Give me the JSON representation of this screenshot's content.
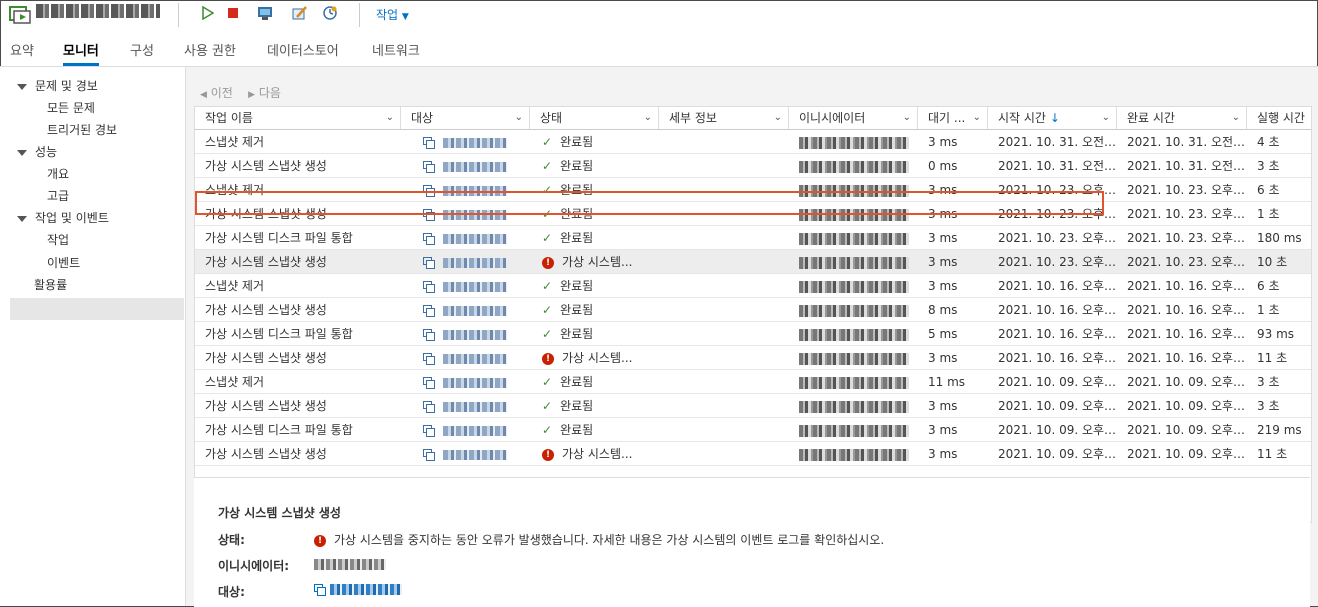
{
  "toolbar": {
    "vm_name": "█████████",
    "actions_label": "작업",
    "actions_icon": "chevron-down-icon",
    "buttons": [
      "power-on-icon",
      "power-off-icon",
      "console-icon",
      "edit-settings-icon",
      "snapshot-icon"
    ]
  },
  "tabs": [
    {
      "label": "요약",
      "active": false
    },
    {
      "label": "모니터",
      "active": true
    },
    {
      "label": "구성",
      "active": false
    },
    {
      "label": "사용 권한",
      "active": false
    },
    {
      "label": "데이터스토어",
      "active": false
    },
    {
      "label": "네트워크",
      "active": false
    }
  ],
  "sidebar": {
    "groups": [
      {
        "label": "문제 및 경보",
        "items": [
          "모든 문제",
          "트리거된 경보"
        ]
      },
      {
        "label": "성능",
        "items": [
          "개요",
          "고급"
        ]
      },
      {
        "label": "작업 및 이벤트",
        "items": [
          "작업",
          "이벤트"
        ]
      }
    ],
    "extra": "활용률",
    "selected": "작업"
  },
  "pager": {
    "prev": "이전",
    "next": "다음"
  },
  "columns": [
    "작업 이름",
    "대상",
    "상태",
    "세부 정보",
    "이니시에이터",
    "대기 ...",
    "시작 시간",
    "완료 시간",
    "실행 시간"
  ],
  "sort_icon": "arrow-down-icon",
  "rows": [
    {
      "name": "스냅샷 제거",
      "status": "완료됨",
      "ok": true,
      "queued": "3 ms",
      "start": "2021. 10. 31. 오전 1...",
      "end": "2021. 10. 31. 오전 1...",
      "run": "4 초"
    },
    {
      "name": "가상 시스템 스냅샷 생성",
      "status": "완료됨",
      "ok": true,
      "queued": "0 ms",
      "start": "2021. 10. 31. 오전 1...",
      "end": "2021. 10. 31. 오전 1...",
      "run": "3 초"
    },
    {
      "name": "스냅샷 제거",
      "status": "완료됨",
      "ok": true,
      "queued": "3 ms",
      "start": "2021. 10. 23. 오후 ...",
      "end": "2021. 10. 23. 오후 ...",
      "run": "6 초"
    },
    {
      "name": "가상 시스템 스냅샷 생성",
      "status": "완료됨",
      "ok": true,
      "queued": "3 ms",
      "start": "2021. 10. 23. 오후 ...",
      "end": "2021. 10. 23. 오후 ...",
      "run": "1 초"
    },
    {
      "name": "가상 시스템 디스크 파일 통합",
      "status": "완료됨",
      "ok": true,
      "queued": "3 ms",
      "start": "2021. 10. 23. 오후 ...",
      "end": "2021. 10. 23. 오후 ...",
      "run": "180 ms"
    },
    {
      "name": "가상 시스템 스냅샷 생성",
      "status": "가상 시스템...",
      "ok": false,
      "queued": "3 ms",
      "start": "2021. 10. 23. 오후 ...",
      "end": "2021. 10. 23. 오후 ...",
      "run": "10 초"
    },
    {
      "name": "스냅샷 제거",
      "status": "완료됨",
      "ok": true,
      "queued": "3 ms",
      "start": "2021. 10. 16. 오후 1...",
      "end": "2021. 10. 16. 오후 1...",
      "run": "6 초"
    },
    {
      "name": "가상 시스템 스냅샷 생성",
      "status": "완료됨",
      "ok": true,
      "queued": "8 ms",
      "start": "2021. 10. 16. 오후 1...",
      "end": "2021. 10. 16. 오후 1...",
      "run": "1 초"
    },
    {
      "name": "가상 시스템 디스크 파일 통합",
      "status": "완료됨",
      "ok": true,
      "queued": "5 ms",
      "start": "2021. 10. 16. 오후 1...",
      "end": "2021. 10. 16. 오후 1...",
      "run": "93 ms"
    },
    {
      "name": "가상 시스템 스냅샷 생성",
      "status": "가상 시스템...",
      "ok": false,
      "queued": "3 ms",
      "start": "2021. 10. 16. 오후 1...",
      "end": "2021. 10. 16. 오후 1...",
      "run": "11 초"
    },
    {
      "name": "스냅샷 제거",
      "status": "완료됨",
      "ok": true,
      "queued": "11 ms",
      "start": "2021. 10. 09. 오후 ...",
      "end": "2021. 10. 09. 오후 ...",
      "run": "3 초"
    },
    {
      "name": "가상 시스템 스냅샷 생성",
      "status": "완료됨",
      "ok": true,
      "queued": "3 ms",
      "start": "2021. 10. 09. 오후 ...",
      "end": "2021. 10. 09. 오후 ...",
      "run": "3 초"
    },
    {
      "name": "가상 시스템 디스크 파일 통합",
      "status": "완료됨",
      "ok": true,
      "queued": "3 ms",
      "start": "2021. 10. 09. 오후 ...",
      "end": "2021. 10. 09. 오후 ...",
      "run": "219 ms"
    },
    {
      "name": "가상 시스템 스냅샷 생성",
      "status": "가상 시스템...",
      "ok": false,
      "queued": "3 ms",
      "start": "2021. 10. 09. 오후 ...",
      "end": "2021. 10. 09. 오후 ...",
      "run": "11 초"
    }
  ],
  "highlighted_row": 3,
  "selected_row": 5,
  "detail": {
    "title": "가상 시스템 스냅샷 생성",
    "status_label": "상태:",
    "status_text": "가상 시스템을 중지하는 동안 오류가 발생했습니다. 자세한 내용은 가상 시스템의 이벤트 로그를 확인하십시오.",
    "initiator_label": "이니시에이터:",
    "target_label": "대상:"
  },
  "colors": {
    "accent": "#0072c6",
    "ok": "#3c8d2f",
    "error": "#c92100",
    "highlight": "#e2542d"
  }
}
